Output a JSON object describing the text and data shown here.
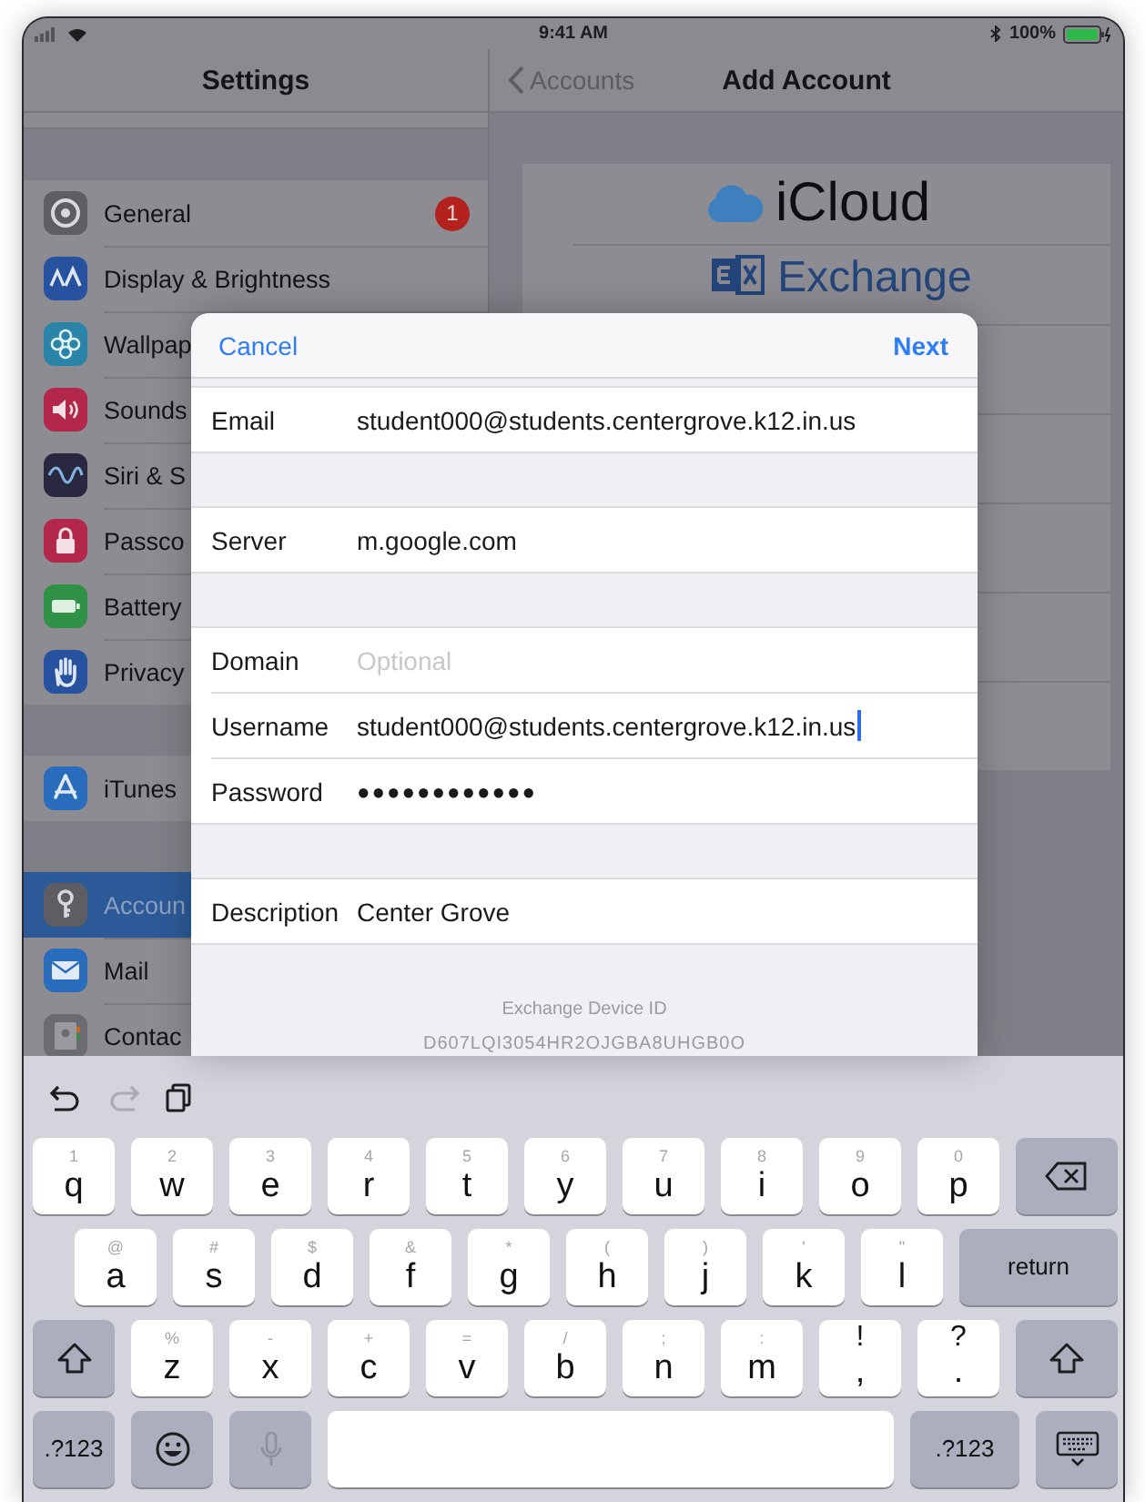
{
  "status_bar": {
    "time": "9:41 AM",
    "battery": "100%"
  },
  "sidebar": {
    "title": "Settings",
    "groups": [
      {
        "items": [
          {
            "label": "General",
            "kind": "gear",
            "color": "#5d5d63",
            "badge": "1",
            "selected": false
          },
          {
            "label": "Display & Brightness",
            "kind": "display",
            "color": "#2652a0",
            "selected": false
          },
          {
            "label": "Wallpap",
            "kind": "flower",
            "color": "#2a84a8",
            "selected": false
          },
          {
            "label": "Sounds",
            "kind": "speaker",
            "color": "#b3284a",
            "selected": false
          },
          {
            "label": "Siri & S",
            "kind": "siri",
            "color": "#2a2840",
            "selected": false
          },
          {
            "label": "Passco",
            "kind": "lock",
            "color": "#b3284a",
            "selected": false
          },
          {
            "label": "Battery",
            "kind": "battery",
            "color": "#2f9146",
            "selected": false
          },
          {
            "label": "Privacy",
            "kind": "hand",
            "color": "#2652a0",
            "selected": false
          }
        ]
      },
      {
        "items": [
          {
            "label": "iTunes",
            "kind": "appstore",
            "color": "#2a6cbc",
            "selected": false
          }
        ]
      },
      {
        "items": [
          {
            "label": "Accoun",
            "kind": "key",
            "color": "#5d5d63",
            "selected": true
          },
          {
            "label": "Mail",
            "kind": "mail",
            "color": "#2a6cbc",
            "selected": false
          },
          {
            "label": "Contac",
            "kind": "contacts",
            "color": "#6b6b70",
            "selected": false
          }
        ]
      }
    ]
  },
  "detail": {
    "back": "Accounts",
    "title": "Add Account",
    "providers": [
      {
        "name": "iCloud",
        "kind": "icloud"
      },
      {
        "name": "Exchange",
        "kind": "exchange"
      }
    ]
  },
  "dialog": {
    "cancel": "Cancel",
    "next": "Next",
    "groups": [
      {
        "fields": [
          {
            "label": "Email",
            "value": "student000@students.centergrove.k12.in.us",
            "kind": "text",
            "focused": false
          }
        ]
      },
      {
        "fields": [
          {
            "label": "Server",
            "value": "m.google.com",
            "kind": "text",
            "focused": false
          }
        ]
      },
      {
        "fields": [
          {
            "label": "Domain",
            "placeholder": "Optional",
            "kind": "text",
            "focused": false
          },
          {
            "label": "Username",
            "value": "student000@students.centergrove.k12.in.us",
            "kind": "text",
            "focused": true
          },
          {
            "label": "Password",
            "value": "●●●●●●●●●●●●",
            "kind": "password",
            "focused": false
          }
        ]
      },
      {
        "fields": [
          {
            "label": "Description",
            "value": "Center Grove",
            "kind": "text",
            "focused": false
          }
        ]
      }
    ],
    "footer": {
      "caption": "Exchange Device ID",
      "device_id": "D607LQI3054HR2OJGBA8UHGB0O"
    }
  },
  "keyboard": {
    "toolbar": [
      {
        "kind": "undo",
        "disabled": false
      },
      {
        "kind": "redo",
        "disabled": true
      },
      {
        "kind": "paste",
        "disabled": false
      }
    ],
    "rows": [
      {
        "keys": [
          {
            "kind": "letter",
            "label": "q",
            "hint": "1"
          },
          {
            "kind": "letter",
            "label": "w",
            "hint": "2"
          },
          {
            "kind": "letter",
            "label": "e",
            "hint": "3"
          },
          {
            "kind": "letter",
            "label": "r",
            "hint": "4"
          },
          {
            "kind": "letter",
            "label": "t",
            "hint": "5"
          },
          {
            "kind": "letter",
            "label": "y",
            "hint": "6"
          },
          {
            "kind": "letter",
            "label": "u",
            "hint": "7"
          },
          {
            "kind": "letter",
            "label": "i",
            "hint": "8"
          },
          {
            "kind": "letter",
            "label": "o",
            "hint": "9"
          },
          {
            "kind": "letter",
            "label": "p",
            "hint": "0"
          },
          {
            "kind": "delete"
          }
        ]
      },
      {
        "keys": [
          {
            "kind": "letter",
            "label": "a",
            "hint": "@"
          },
          {
            "kind": "letter",
            "label": "s",
            "hint": "#"
          },
          {
            "kind": "letter",
            "label": "d",
            "hint": "$"
          },
          {
            "kind": "letter",
            "label": "f",
            "hint": "&"
          },
          {
            "kind": "letter",
            "label": "g",
            "hint": "*"
          },
          {
            "kind": "letter",
            "label": "h",
            "hint": "("
          },
          {
            "kind": "letter",
            "label": "j",
            "hint": ")"
          },
          {
            "kind": "letter",
            "label": "k",
            "hint": "'"
          },
          {
            "kind": "letter",
            "label": "l",
            "hint": "\""
          },
          {
            "kind": "return",
            "label": "return"
          }
        ]
      },
      {
        "keys": [
          {
            "kind": "shift"
          },
          {
            "kind": "letter",
            "label": "z",
            "hint": "%"
          },
          {
            "kind": "letter",
            "label": "x",
            "hint": "-"
          },
          {
            "kind": "letter",
            "label": "c",
            "hint": "+"
          },
          {
            "kind": "letter",
            "label": "v",
            "hint": "="
          },
          {
            "kind": "letter",
            "label": "b",
            "hint": "/"
          },
          {
            "kind": "letter",
            "label": "n",
            "hint": ";"
          },
          {
            "kind": "letter",
            "label": "m",
            "hint": ":"
          },
          {
            "kind": "punct",
            "label": ",",
            "hint": "!"
          },
          {
            "kind": "punct",
            "label": ".",
            "hint": "?"
          },
          {
            "kind": "shift"
          }
        ]
      },
      {
        "keys": [
          {
            "kind": "numbers",
            "label": ".?123"
          },
          {
            "kind": "emoji"
          },
          {
            "kind": "mic",
            "disabled": true
          },
          {
            "kind": "space"
          },
          {
            "kind": "numbers",
            "label": ".?123"
          },
          {
            "kind": "hide"
          }
        ]
      }
    ]
  }
}
